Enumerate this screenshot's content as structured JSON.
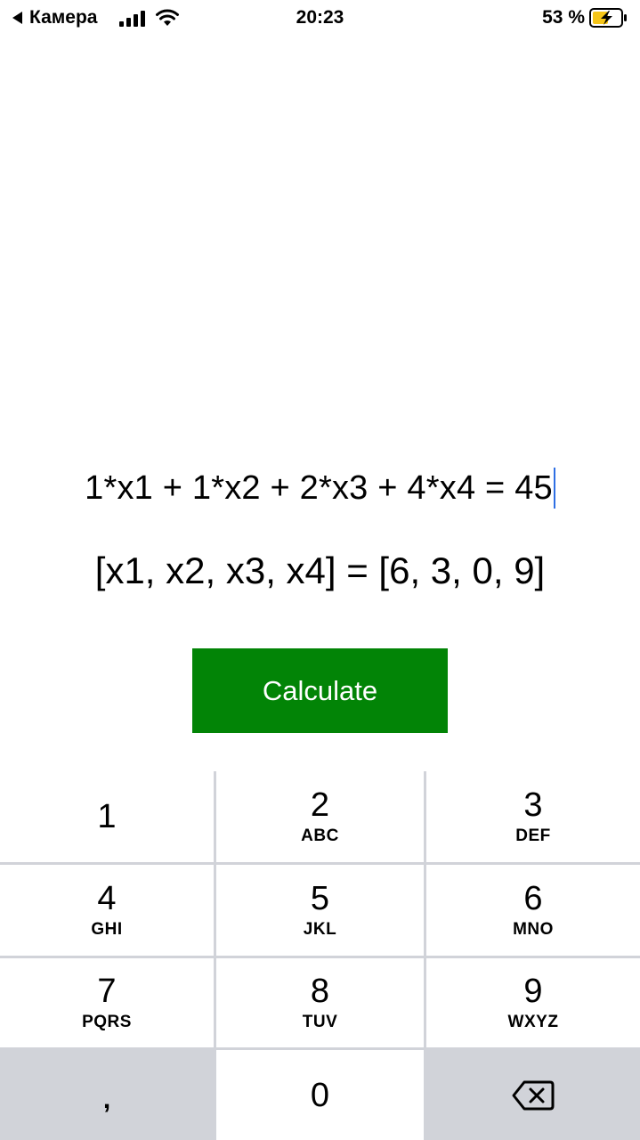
{
  "status_bar": {
    "back_label": "Камера",
    "time": "20:23",
    "battery_percent": "53 %",
    "icons": [
      "back-triangle-icon",
      "signal-bars-icon",
      "wifi-icon",
      "battery-charging-icon"
    ]
  },
  "main": {
    "equation": "1*x1 + 1*x2 + 2*x3 + 4*x4 = 45",
    "result": "[x1, x2, x3, x4] = [6, 3, 0, 9]",
    "calculate_label": "Calculate"
  },
  "colors": {
    "button": "#028406",
    "caret": "#2f6fe4",
    "keypad_background": "#d1d3d9"
  },
  "keypad": {
    "keys": [
      {
        "digit": "1",
        "letters": ""
      },
      {
        "digit": "2",
        "letters": "ABC"
      },
      {
        "digit": "3",
        "letters": "DEF"
      },
      {
        "digit": "4",
        "letters": "GHI"
      },
      {
        "digit": "5",
        "letters": "JKL"
      },
      {
        "digit": "6",
        "letters": "MNO"
      },
      {
        "digit": "7",
        "letters": "PQRS"
      },
      {
        "digit": "8",
        "letters": "TUV"
      },
      {
        "digit": "9",
        "letters": "WXYZ"
      }
    ],
    "comma": ",",
    "zero": "0",
    "delete_icon": "backspace-icon"
  }
}
